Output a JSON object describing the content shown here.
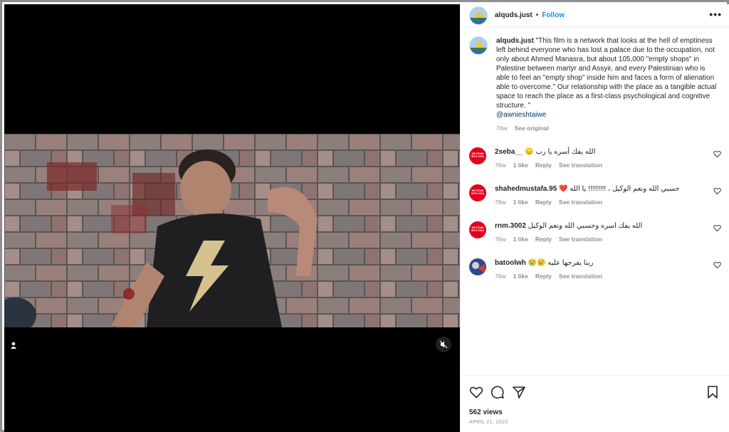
{
  "post": {
    "username": "alquds.just",
    "follow_label": "Follow",
    "separator": "•",
    "more_label": "•••",
    "caption_user": "alquds.just",
    "caption_text": "\"This film is a network that looks at the hell of emptiness left behind everyone who has lost a palace due to the occupation, not only about Ahmed Manasra, but about 105,000 \"empty shops\" in Palestine between martyr and Assyir, and every Palestinian who is able to feel an \"empty shop\" inside him and faces a form of alienation able to overcome.\" Our relationship with the place as a tangible actual space to reach the place as a first-class psychological and cognitive structure. \"",
    "caption_mention": "@awnieshtaiwe",
    "caption_time": "76w",
    "caption_see_original": "See original",
    "views": "562 views",
    "date": "APRIL 21, 2022"
  },
  "comments": [
    {
      "user": "2seba__",
      "text": "الله يفك أسره يا رب 😞",
      "time": "76w",
      "likes": "1 like",
      "reply": "Reply",
      "translation": "See translation"
    },
    {
      "user": "shahedmustafa.95",
      "text": "حسبي الله ونعم الوكيل ، !!!!!!!!! يا الله ❤️",
      "time": "76w",
      "likes": "1 like",
      "reply": "Reply",
      "translation": "See translation"
    },
    {
      "user": "rnm.3002",
      "text": "الله يفك اسره وحسبي الله ونعم الوكيل",
      "time": "76w",
      "likes": "1 like",
      "reply": "Reply",
      "translation": "See translation"
    },
    {
      "user": "batoolwh",
      "text": "ربنا يفرجها عليه 😢😢",
      "time": "76w",
      "likes": "1 like",
      "reply": "Reply",
      "translation": "See translation"
    }
  ],
  "avatar_badge_text": "WE STAND WITH GAZA",
  "icons": {
    "like": "heart-icon",
    "comment": "comment-icon",
    "share": "share-icon",
    "save": "bookmark-icon",
    "mute": "muted-speaker-icon",
    "tag": "user-tag-icon"
  },
  "colors": {
    "follow": "#0095f6",
    "secondary_text": "#8e8e8e",
    "badge": "#e3001b"
  }
}
